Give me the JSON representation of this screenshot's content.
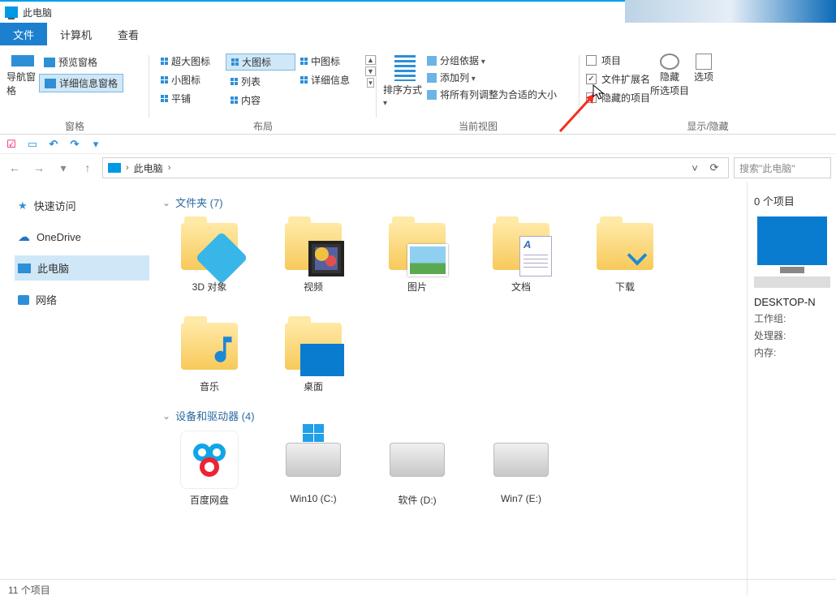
{
  "window": {
    "title": "此电脑"
  },
  "tabs": {
    "file": "文件",
    "computer": "计算机",
    "view": "查看"
  },
  "ribbon": {
    "panes": {
      "nav": "导航窗格",
      "preview": "预览窗格",
      "details": "详细信息窗格",
      "group": "窗格"
    },
    "layout": {
      "xl": "超大图标",
      "l": "大图标",
      "m": "中图标",
      "s": "小图标",
      "list": "列表",
      "detail": "详细信息",
      "tile": "平铺",
      "content": "内容",
      "group": "布局"
    },
    "view": {
      "sort": "排序方式",
      "groupby": "分组依据",
      "addcol": "添加列",
      "fitcols": "将所有列调整为合适的大小",
      "group": "当前视图"
    },
    "show": {
      "itemcheck": "项目",
      "ext": "文件扩展名",
      "hidden": "隐藏的项目",
      "hide": "隐藏",
      "hide2": "所选项目",
      "options": "选项",
      "group": "显示/隐藏"
    }
  },
  "address": {
    "crumb": "此电脑",
    "search_placeholder": "搜索\"此电脑\""
  },
  "tree": {
    "quick": "快速访问",
    "onedrive": "OneDrive",
    "thispc": "此电脑",
    "network": "网络"
  },
  "content": {
    "folders_header": "文件夹 (7)",
    "drives_header": "设备和驱动器 (4)",
    "folders": {
      "obj3d": "3D 对象",
      "video": "视频",
      "pic": "图片",
      "doc": "文档",
      "dl": "下载",
      "music": "音乐",
      "desktop": "桌面"
    },
    "drives": {
      "baidu": "百度网盘",
      "c": "Win10 (C:)",
      "d": "软件 (D:)",
      "e": "Win7 (E:)"
    }
  },
  "details": {
    "header": "0 个项目",
    "pcname": "DESKTOP-N",
    "workgroup": "工作组:",
    "processor": "处理器:",
    "memory": "内存:"
  },
  "status": {
    "items": "11 个项目"
  }
}
